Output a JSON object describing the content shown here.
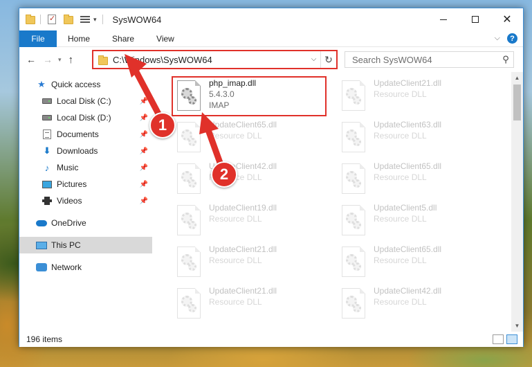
{
  "window": {
    "title": "SysWOW64",
    "controls": {
      "minimize_icon": "minimize-icon",
      "maximize_icon": "maximize-icon",
      "close_icon": "close-icon"
    }
  },
  "ribbon": {
    "tabs": [
      {
        "label": "File",
        "active": true
      },
      {
        "label": "Home"
      },
      {
        "label": "Share"
      },
      {
        "label": "View"
      }
    ],
    "help_glyph": "?"
  },
  "navigation": {
    "back": "←",
    "forward": "→",
    "recent": "▾",
    "up": "↑",
    "address": "C:\\Windows\\SysWOW64",
    "search_placeholder": "Search SysWOW64"
  },
  "sidebar": {
    "items": [
      {
        "label": "Quick access",
        "icon": "star-icon",
        "pinned": false
      },
      {
        "label": "Local Disk (C:)",
        "icon": "drive-icon",
        "pinned": true
      },
      {
        "label": "Local Disk (D:)",
        "icon": "drive-icon",
        "pinned": true
      },
      {
        "label": "Documents",
        "icon": "documents-icon",
        "pinned": true
      },
      {
        "label": "Downloads",
        "icon": "download-icon",
        "pinned": true
      },
      {
        "label": "Music",
        "icon": "music-icon",
        "pinned": true
      },
      {
        "label": "Pictures",
        "icon": "pictures-icon",
        "pinned": true
      },
      {
        "label": "Videos",
        "icon": "videos-icon",
        "pinned": true
      },
      {
        "label": "OneDrive",
        "icon": "cloud-icon",
        "pinned": false
      },
      {
        "label": "This PC",
        "icon": "computer-icon",
        "pinned": false,
        "selected": true
      },
      {
        "label": "Network",
        "icon": "network-icon",
        "pinned": false
      }
    ]
  },
  "files": [
    {
      "name": "php_imap.dll",
      "line2": "5.4.3.0",
      "line3": "IMAP",
      "highlighted": true
    },
    {
      "name": "UpdateClient21.dll",
      "line2": "Resource DLL"
    },
    {
      "name": "UpdateClient65.dll",
      "line2": "Resource DLL"
    },
    {
      "name": "UpdateClient63.dll",
      "line2": "Resource DLL"
    },
    {
      "name": "UpdateClient42.dll",
      "line2": "Resource DLL"
    },
    {
      "name": "UpdateClient65.dll",
      "line2": "Resource DLL"
    },
    {
      "name": "UpdateClient19.dll",
      "line2": "Resource DLL"
    },
    {
      "name": "UpdateClient5.dll",
      "line2": "Resource DLL"
    },
    {
      "name": "UpdateClient21.dll",
      "line2": "Resource DLL"
    },
    {
      "name": "UpdateClient65.dll",
      "line2": "Resource DLL"
    },
    {
      "name": "UpdateClient21.dll",
      "line2": "Resource DLL"
    },
    {
      "name": "UpdateClient42.dll",
      "line2": "Resource DLL"
    }
  ],
  "status": {
    "item_count": "196 items"
  },
  "annotations": [
    {
      "number": "1"
    },
    {
      "number": "2"
    }
  ],
  "colors": {
    "accent": "#1979ca",
    "highlight": "#e0312a"
  }
}
